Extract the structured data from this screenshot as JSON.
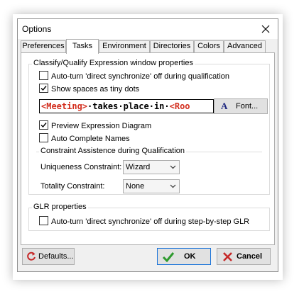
{
  "window": {
    "title": "Options"
  },
  "tabs": [
    "Preferences",
    "Tasks",
    "Environment",
    "Directories",
    "Colors",
    "Advanced"
  ],
  "active_tab": "Tasks",
  "classify_group": {
    "label": "Classify/Qualify Expression window properties",
    "options": [
      {
        "label": "Auto-turn 'direct synchronize' off during qualification",
        "checked": false
      },
      {
        "label": "Show spaces as tiny dots",
        "checked": true
      }
    ],
    "sample": {
      "tag1": "<Meeting>",
      "mid": "·takes·place·in·",
      "tag2": "<Roo"
    },
    "font_button": {
      "icon": "A",
      "label": "Font..."
    },
    "options2": [
      {
        "label": "Preview Expression Diagram",
        "checked": true
      },
      {
        "label": "Auto Complete Names",
        "checked": false
      }
    ],
    "constraint_group": {
      "label": "Constraint Assistence during Qualification",
      "uniqueness_label": "Uniqueness Constraint:",
      "uniqueness_value": "Wizard",
      "totality_label": "Totality Constraint:",
      "totality_value": "None"
    }
  },
  "glr_group": {
    "label": "GLR properties",
    "option": {
      "label": "Auto-turn 'direct synchronize' off during step-by-step GLR",
      "checked": false
    }
  },
  "buttons": {
    "defaults": "Defaults...",
    "ok": "OK",
    "cancel": "Cancel"
  }
}
